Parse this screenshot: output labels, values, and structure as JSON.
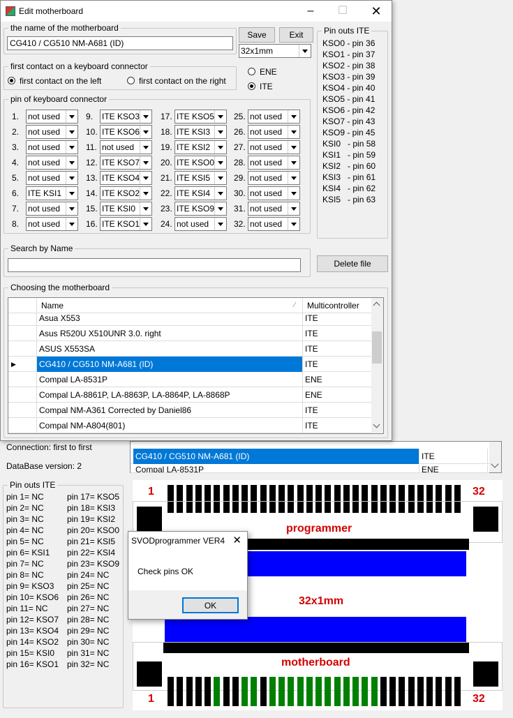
{
  "dialog": {
    "title": "Edit motherboard",
    "name_group": "the name of the motherboard",
    "name_value": "CG410 / CG510 NM-A681 (ID)",
    "save": "Save",
    "exit": "Exit",
    "connector_value": "32x1mm",
    "contact_group": "first contact on a keyboard connector",
    "contact_left": "first contact on the left",
    "contact_right": "first contact on the right",
    "ene": "ENE",
    "ite": "ITE",
    "pins_group": "pin of keyboard connector",
    "pins": [
      {
        "n": "1.",
        "v": "not used"
      },
      {
        "n": "2.",
        "v": "not used"
      },
      {
        "n": "3.",
        "v": "not used"
      },
      {
        "n": "4.",
        "v": "not used"
      },
      {
        "n": "5.",
        "v": "not used"
      },
      {
        "n": "6.",
        "v": "ITE KSI1"
      },
      {
        "n": "7.",
        "v": "not used"
      },
      {
        "n": "8.",
        "v": "not used"
      },
      {
        "n": "9.",
        "v": "ITE KSO3"
      },
      {
        "n": "10.",
        "v": "ITE KSO6"
      },
      {
        "n": "11.",
        "v": "not used"
      },
      {
        "n": "12.",
        "v": "ITE KSO7"
      },
      {
        "n": "13.",
        "v": "ITE KSO4"
      },
      {
        "n": "14.",
        "v": "ITE KSO2"
      },
      {
        "n": "15.",
        "v": "ITE KSI0"
      },
      {
        "n": "16.",
        "v": "ITE KSO1"
      },
      {
        "n": "17.",
        "v": "ITE KSO5"
      },
      {
        "n": "18.",
        "v": "ITE KSI3"
      },
      {
        "n": "19.",
        "v": "ITE KSI2"
      },
      {
        "n": "20.",
        "v": "ITE KSO0"
      },
      {
        "n": "21.",
        "v": "ITE KSI5"
      },
      {
        "n": "22.",
        "v": "ITE KSI4"
      },
      {
        "n": "23.",
        "v": "ITE KSO9"
      },
      {
        "n": "24.",
        "v": "not used"
      },
      {
        "n": "25.",
        "v": "not used"
      },
      {
        "n": "26.",
        "v": "not used"
      },
      {
        "n": "27.",
        "v": "not used"
      },
      {
        "n": "28.",
        "v": "not used"
      },
      {
        "n": "29.",
        "v": "not used"
      },
      {
        "n": "30.",
        "v": "not used"
      },
      {
        "n": "31.",
        "v": "not used"
      },
      {
        "n": "32.",
        "v": "not used"
      }
    ],
    "pinouts_group": "Pin outs ITE",
    "pinouts": [
      "KSO0 - pin 36",
      "KSO1 - pin 37",
      "KSO2 - pin 38",
      "KSO3 - pin 39",
      "KSO4 - pin 40",
      "KSO5 - pin 41",
      "KSO6 - pin 42",
      "KSO7 - pin 43",
      "KSO9 - pin 45",
      "KSI0   - pin 58",
      "KSI1   - pin 59",
      "KSI2   - pin 60",
      "KSI3   - pin 61",
      "KSI4   - pin 62",
      "KSI5   - pin 63"
    ],
    "search_group": "Search by Name",
    "search_value": "",
    "delete_file": "Delete file",
    "choose_group": "Choosing the motherboard",
    "col_name": "Name",
    "col_multi": "Multicontroller",
    "rows": [
      {
        "name": "Asua X553",
        "multi": "ITE"
      },
      {
        "name": "Asus R520U X510UNR 3.0. right",
        "multi": "ITE"
      },
      {
        "name": "ASUS X553SA",
        "multi": "ITE"
      },
      {
        "name": "CG410 / CG510 NM-A681 (ID)",
        "multi": "ITE"
      },
      {
        "name": "Compal LA-8531P",
        "multi": "ENE"
      },
      {
        "name": "Compal LA-8861P, LA-8863P, LA-8864P, LA-8868P",
        "multi": "ENE"
      },
      {
        "name": "Compal NM-A361 Corrected by Daniel86",
        "multi": "ITE"
      },
      {
        "name": "Compal NM-A804(801)",
        "multi": "ITE"
      }
    ],
    "selected_row": 3
  },
  "main": {
    "connection": "Connection: first to first",
    "db_version": "DataBase version: 2",
    "bg_selected_name": "CG410 / CG510 NM-A681 (ID)",
    "bg_selected_multi": "ITE",
    "bg_next_name": "Compal LA-8531P",
    "bg_next_multi": "ENE",
    "pinouts_group": "Pin outs ITE",
    "pins_left": [
      "pin 1= NC",
      "pin 2= NC",
      "pin 3= NC",
      "pin 4= NC",
      "pin 5= NC",
      "pin 6= KSI1",
      "pin 7= NC",
      "pin 8= NC",
      "pin 9= KSO3",
      "pin 10= KSO6",
      "pin 11= NC",
      "pin 12= KSO7",
      "pin 13= KSO4",
      "pin 14= KSO2",
      "pin 15= KSI0",
      "pin 16= KSO1"
    ],
    "pins_right": [
      "pin 17= KSO5",
      "pin 18= KSI3",
      "pin 19= KSI2",
      "pin 20= KSO0",
      "pin 21= KSI5",
      "pin 22= KSI4",
      "pin 23= KSO9",
      "pin 24= NC",
      "pin 25= NC",
      "pin 26= NC",
      "pin 27= NC",
      "pin 28= NC",
      "pin 29= NC",
      "pin 30= NC",
      "pin 31= NC",
      "pin 32= NC"
    ],
    "diagram": {
      "top_first": "1",
      "top_last": "32",
      "programmer": "programmer",
      "cable": "32x1mm",
      "motherboard": "motherboard",
      "bot_first": "1",
      "bot_last": "32",
      "green_pins": [
        6,
        9,
        10,
        12,
        13,
        14,
        15,
        16,
        17,
        18,
        19,
        20,
        21,
        22,
        23
      ]
    }
  },
  "msgbox": {
    "title": "SVODprogrammer VER4",
    "text": "Check pins OK",
    "ok": "OK"
  },
  "colors": {
    "accent": "#0078d7",
    "blue": "#0000ff",
    "red": "#d40000",
    "green": "#008000"
  }
}
